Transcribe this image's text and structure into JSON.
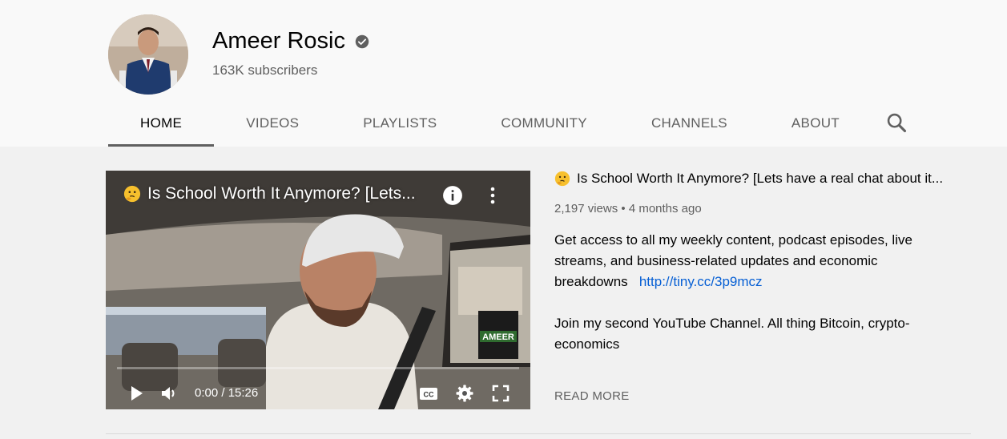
{
  "channel": {
    "name": "Ameer Rosic",
    "subscribers": "163K subscribers"
  },
  "tabs": [
    {
      "label": "HOME",
      "active": true
    },
    {
      "label": "VIDEOS"
    },
    {
      "label": "PLAYLISTS"
    },
    {
      "label": "COMMUNITY"
    },
    {
      "label": "CHANNELS"
    },
    {
      "label": "ABOUT"
    }
  ],
  "player": {
    "title": "Is School Worth It Anymore? [Lets...",
    "time": "0:00 / 15:26",
    "progress": 0,
    "watermark": "AMEER"
  },
  "video": {
    "title": "Is School Worth It Anymore? [Lets have a real chat about it...",
    "views": "2,197 views",
    "age": "4 months ago",
    "description_1": "Get access to all my weekly content, podcast episodes, live streams, and business-related updates and economic breakdowns",
    "link": "http://tiny.cc/3p9mcz",
    "description_2": "Join my second YouTube Channel. All thing Bitcoin, crypto-economics",
    "read_more": "READ MORE"
  },
  "icons": {
    "verified": "check-circle-icon",
    "search": "search-icon",
    "emoji": "thinking-face-icon",
    "info": "info-icon",
    "more": "more-vert-icon",
    "play": "play-icon",
    "volume": "volume-icon",
    "captions": "cc-icon",
    "settings": "gear-icon",
    "fullscreen": "fullscreen-icon"
  },
  "colors": {
    "link": "#065fd4",
    "header_bg": "#f9f9f9",
    "page_bg": "#f1f1f1",
    "secondary_text": "#606060"
  }
}
